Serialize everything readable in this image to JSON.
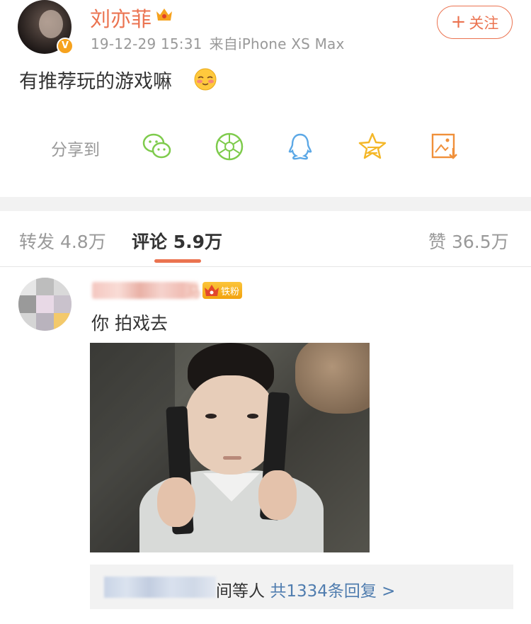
{
  "post": {
    "author": "刘亦菲",
    "timestamp": "19-12-29 15:31",
    "source": "来自iPhone XS Max",
    "follow_label": "关注",
    "follow_plus": "+",
    "text": "有推荐玩的游戏嘛",
    "verified_mark": "V"
  },
  "share": {
    "label": "分享到",
    "targets": [
      "wechat-icon",
      "moments-icon",
      "qq-icon",
      "qzone-icon",
      "save-image-icon"
    ]
  },
  "tabs": {
    "repost": "转发 4.8万",
    "comment_label": "评论",
    "comment_count": "5.9万",
    "like": "赞 36.5万"
  },
  "comment": {
    "author_tail": "马",
    "badge": "铁粉",
    "text": "你  拍戏去",
    "replies_suffix": "间等人",
    "replies_link": "共1334条回复 >"
  },
  "colors": {
    "accent": "#eb7350",
    "share_green": "#7ecb4c",
    "share_blue": "#5ca8e6",
    "share_yellow": "#f4b728",
    "share_orange": "#f0903a",
    "link": "#507daf"
  }
}
